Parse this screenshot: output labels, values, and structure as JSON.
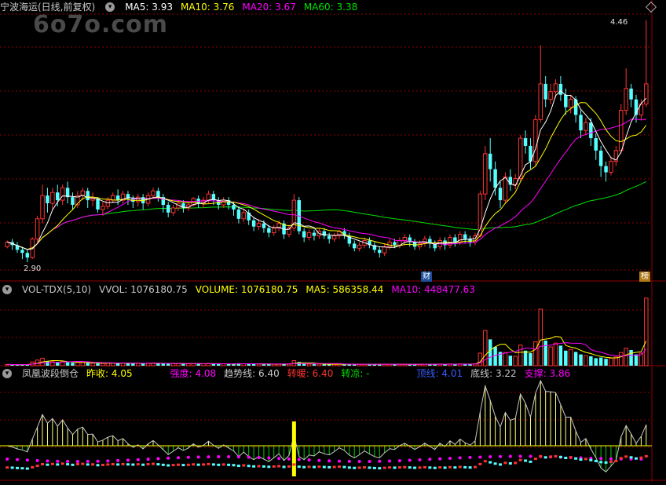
{
  "header": {
    "stock": "宁波海运(日线,前复权)",
    "ma5": "MA5: 3.93",
    "ma10": "MA10: 3.76",
    "ma20": "MA20: 3.67",
    "ma60": "MA60: 3.38",
    "watermark": "6o7o.com",
    "high_label": "4.46",
    "low_label": "2.90",
    "tag_cai": "财",
    "tag_bang": "榜"
  },
  "volume_header": {
    "indicator": "VOL-TDX(5,10)",
    "vvol": "VVOL: 1076180.75",
    "volume": "VOLUME: 1076180.75",
    "ma5": "MA5: 586358.44",
    "ma10": "MA10: 448477.63"
  },
  "indicator_header": {
    "name": "凤凰波段倒仓",
    "prev_close": "昨收: 4.05",
    "strength": "强度: 4.08",
    "trend": "趋势线: 6.40",
    "warm": "转暖: 6.40",
    "cool": "转凉: -",
    "resist": "顶线: 4.01",
    "floor": "底线: 3.22",
    "support": "支撑: 3.86"
  },
  "colors": {
    "up": "#ff3232",
    "down": "#54ffff",
    "ma5": "#ffffff",
    "ma10": "#ffff00",
    "ma20": "#ff00ff",
    "ma60": "#00e000",
    "grid": "#8b0000"
  },
  "chart_data": {
    "type": "candlestick",
    "price_axis_range": [
      2.85,
      4.5
    ],
    "extreme_labels": {
      "high": 4.46,
      "low": 2.9
    },
    "candles": [
      [
        3.0,
        3.03,
        3.04,
        2.99
      ],
      [
        3.03,
        3.01,
        3.05,
        2.98
      ],
      [
        3.01,
        2.98,
        3.03,
        2.96
      ],
      [
        2.98,
        2.96,
        3.0,
        2.92
      ],
      [
        2.96,
        2.93,
        2.98,
        2.9
      ],
      [
        2.93,
        3.05,
        3.06,
        2.92
      ],
      [
        3.05,
        3.18,
        3.2,
        3.03
      ],
      [
        3.18,
        3.33,
        3.4,
        3.15
      ],
      [
        3.33,
        3.28,
        3.38,
        3.22
      ],
      [
        3.28,
        3.35,
        3.38,
        3.24
      ],
      [
        3.35,
        3.3,
        3.4,
        3.26
      ],
      [
        3.3,
        3.38,
        3.4,
        3.27
      ],
      [
        3.38,
        3.32,
        3.42,
        3.28
      ],
      [
        3.32,
        3.27,
        3.35,
        3.24
      ],
      [
        3.27,
        3.33,
        3.36,
        3.25
      ],
      [
        3.33,
        3.36,
        3.38,
        3.3
      ],
      [
        3.36,
        3.3,
        3.38,
        3.25
      ],
      [
        3.3,
        3.31,
        3.35,
        3.26
      ],
      [
        3.31,
        3.24,
        3.32,
        3.22
      ],
      [
        3.24,
        3.26,
        3.29,
        3.2
      ],
      [
        3.26,
        3.3,
        3.32,
        3.24
      ],
      [
        3.3,
        3.33,
        3.35,
        3.28
      ],
      [
        3.33,
        3.3,
        3.37,
        3.27
      ],
      [
        3.3,
        3.34,
        3.36,
        3.28
      ],
      [
        3.34,
        3.31,
        3.36,
        3.27
      ],
      [
        3.31,
        3.29,
        3.33,
        3.25
      ],
      [
        3.29,
        3.32,
        3.34,
        3.26
      ],
      [
        3.32,
        3.28,
        3.34,
        3.24
      ],
      [
        3.28,
        3.33,
        3.35,
        3.26
      ],
      [
        3.33,
        3.36,
        3.38,
        3.31
      ],
      [
        3.36,
        3.32,
        3.38,
        3.29
      ],
      [
        3.32,
        3.27,
        3.34,
        3.22
      ],
      [
        3.27,
        3.22,
        3.29,
        3.19
      ],
      [
        3.22,
        3.25,
        3.27,
        3.2
      ],
      [
        3.25,
        3.28,
        3.3,
        3.23
      ],
      [
        3.28,
        3.25,
        3.3,
        3.22
      ],
      [
        3.25,
        3.27,
        3.29,
        3.23
      ],
      [
        3.27,
        3.31,
        3.32,
        3.26
      ],
      [
        3.31,
        3.28,
        3.33,
        3.25
      ],
      [
        3.28,
        3.3,
        3.32,
        3.25
      ],
      [
        3.3,
        3.34,
        3.36,
        3.28
      ],
      [
        3.34,
        3.3,
        3.36,
        3.27
      ],
      [
        3.3,
        3.27,
        3.32,
        3.24
      ],
      [
        3.27,
        3.3,
        3.32,
        3.25
      ],
      [
        3.3,
        3.27,
        3.32,
        3.24
      ],
      [
        3.27,
        3.24,
        3.29,
        3.2
      ],
      [
        3.24,
        3.18,
        3.26,
        3.15
      ],
      [
        3.18,
        3.22,
        3.24,
        3.16
      ],
      [
        3.22,
        3.17,
        3.24,
        3.14
      ],
      [
        3.17,
        3.13,
        3.19,
        3.1
      ],
      [
        3.13,
        3.15,
        3.18,
        3.11
      ],
      [
        3.15,
        3.12,
        3.17,
        3.09
      ],
      [
        3.12,
        3.09,
        3.14,
        3.06
      ],
      [
        3.09,
        3.12,
        3.14,
        3.07
      ],
      [
        3.12,
        3.15,
        3.17,
        3.1
      ],
      [
        3.15,
        3.08,
        3.17,
        3.05
      ],
      [
        3.08,
        3.12,
        3.14,
        3.06
      ],
      [
        3.12,
        3.3,
        3.34,
        3.1
      ],
      [
        3.3,
        3.1,
        3.32,
        3.08
      ],
      [
        3.1,
        3.06,
        3.12,
        3.03
      ],
      [
        3.06,
        3.09,
        3.11,
        3.04
      ],
      [
        3.09,
        3.07,
        3.11,
        3.04
      ],
      [
        3.07,
        3.1,
        3.12,
        3.05
      ],
      [
        3.1,
        3.07,
        3.12,
        3.05
      ],
      [
        3.07,
        3.05,
        3.09,
        3.02
      ],
      [
        3.05,
        3.07,
        3.09,
        3.03
      ],
      [
        3.07,
        3.1,
        3.11,
        3.05
      ],
      [
        3.1,
        3.07,
        3.12,
        3.05
      ],
      [
        3.07,
        3.02,
        3.09,
        3.0
      ],
      [
        3.02,
        2.99,
        3.04,
        2.97
      ],
      [
        2.99,
        3.01,
        3.03,
        2.97
      ],
      [
        3.01,
        3.04,
        3.06,
        2.99
      ],
      [
        3.04,
        3.01,
        3.06,
        2.99
      ],
      [
        3.01,
        2.98,
        3.03,
        2.96
      ],
      [
        2.98,
        2.96,
        3.0,
        2.93
      ],
      [
        2.96,
        3.0,
        3.02,
        2.94
      ],
      [
        3.0,
        3.03,
        3.05,
        2.98
      ],
      [
        3.03,
        3.01,
        3.05,
        2.99
      ],
      [
        3.01,
        3.04,
        3.06,
        2.99
      ],
      [
        3.04,
        3.06,
        3.08,
        3.01
      ],
      [
        3.06,
        3.03,
        3.08,
        3.0
      ],
      [
        3.03,
        3.0,
        3.05,
        2.98
      ],
      [
        3.0,
        3.02,
        3.04,
        2.98
      ],
      [
        3.02,
        3.05,
        3.07,
        3.0
      ],
      [
        3.05,
        3.02,
        3.07,
        2.99
      ],
      [
        3.02,
        2.99,
        3.04,
        2.97
      ],
      [
        3.0,
        3.04,
        3.06,
        2.98
      ],
      [
        3.04,
        3.01,
        3.06,
        2.98
      ],
      [
        3.01,
        3.06,
        3.08,
        2.99
      ],
      [
        3.06,
        3.03,
        3.08,
        3.0
      ],
      [
        3.03,
        3.08,
        3.1,
        3.01
      ],
      [
        3.08,
        3.05,
        3.1,
        3.02
      ],
      [
        3.05,
        3.03,
        3.07,
        3.0
      ],
      [
        3.03,
        3.07,
        3.09,
        3.01
      ],
      [
        3.07,
        3.34,
        3.36,
        3.06
      ],
      [
        3.34,
        3.6,
        3.65,
        3.3
      ],
      [
        3.6,
        3.5,
        3.7,
        3.42
      ],
      [
        3.5,
        3.38,
        3.55,
        3.33
      ],
      [
        3.38,
        3.3,
        3.42,
        3.25
      ],
      [
        3.3,
        3.45,
        3.48,
        3.28
      ],
      [
        3.45,
        3.4,
        3.5,
        3.36
      ],
      [
        3.4,
        3.44,
        3.47,
        3.37
      ],
      [
        3.44,
        3.7,
        3.72,
        3.42
      ],
      [
        3.7,
        3.65,
        3.75,
        3.6
      ],
      [
        3.65,
        3.55,
        3.7,
        3.5
      ],
      [
        3.55,
        3.82,
        3.85,
        3.52
      ],
      [
        3.82,
        4.05,
        4.3,
        3.8
      ],
      [
        4.05,
        3.95,
        4.1,
        3.9
      ],
      [
        3.95,
        4.0,
        4.05,
        3.92
      ],
      [
        4.0,
        4.05,
        4.08,
        3.96
      ],
      [
        4.05,
        3.98,
        4.1,
        3.94
      ],
      [
        3.98,
        3.9,
        4.02,
        3.85
      ],
      [
        3.9,
        3.95,
        3.98,
        3.86
      ],
      [
        3.95,
        3.85,
        3.97,
        3.8
      ],
      [
        3.85,
        3.75,
        3.88,
        3.7
      ],
      [
        3.75,
        3.8,
        3.83,
        3.72
      ],
      [
        3.8,
        3.7,
        3.83,
        3.65
      ],
      [
        3.7,
        3.62,
        3.73,
        3.56
      ],
      [
        3.62,
        3.52,
        3.65,
        3.45
      ],
      [
        3.52,
        3.48,
        3.55,
        3.42
      ],
      [
        3.48,
        3.55,
        3.58,
        3.46
      ],
      [
        3.55,
        3.62,
        3.65,
        3.52
      ],
      [
        3.62,
        3.88,
        3.92,
        3.6
      ],
      [
        3.88,
        4.02,
        4.15,
        3.85
      ],
      [
        4.02,
        3.95,
        4.05,
        3.9
      ],
      [
        3.95,
        3.85,
        3.98,
        3.8
      ],
      [
        3.85,
        3.92,
        3.95,
        3.82
      ],
      [
        3.92,
        4.05,
        4.46,
        3.9
      ]
    ],
    "ma": {
      "MA5": {
        "color": "#ffffff",
        "last": 3.93
      },
      "MA10": {
        "color": "#ffff00",
        "last": 3.76
      },
      "MA20": {
        "color": "#ff00ff",
        "last": 3.67
      },
      "MA60": {
        "color": "#00e000",
        "last": 3.38
      }
    },
    "volume": {
      "last": 1076180.75,
      "ma5_last": 586358.44,
      "ma10_last": 448477.63,
      "values": [
        20000,
        18000,
        15000,
        16000,
        22000,
        60000,
        90000,
        120000,
        70000,
        65000,
        60000,
        68000,
        55000,
        48000,
        52000,
        50000,
        45000,
        40000,
        38000,
        36000,
        42000,
        45000,
        40000,
        44000,
        39000,
        35000,
        38000,
        33000,
        40000,
        45000,
        38000,
        34000,
        32000,
        33000,
        36000,
        31000,
        30000,
        34000,
        31000,
        32000,
        36000,
        30000,
        28000,
        30000,
        28000,
        26000,
        40000,
        30000,
        32000,
        28000,
        25000,
        26000,
        24000,
        25000,
        27000,
        30000,
        26000,
        80000,
        60000,
        30000,
        25000,
        24000,
        25000,
        23000,
        22000,
        24000,
        25000,
        23000,
        26000,
        24000,
        22000,
        23000,
        22000,
        24000,
        25000,
        22000,
        24000,
        23000,
        22000,
        24000,
        23000,
        22000,
        24000,
        25000,
        23000,
        22000,
        26000,
        24000,
        27000,
        25000,
        28000,
        26000,
        24000,
        30000,
        200000,
        560000,
        420000,
        300000,
        220000,
        210000,
        160000,
        150000,
        330000,
        240000,
        200000,
        380000,
        900000,
        400000,
        300000,
        360000,
        320000,
        240000,
        260000,
        220000,
        180000,
        160000,
        150000,
        120000,
        130000,
        110000,
        120000,
        140000,
        210000,
        280000,
        250000,
        180000,
        200000,
        1076180
      ]
    }
  }
}
